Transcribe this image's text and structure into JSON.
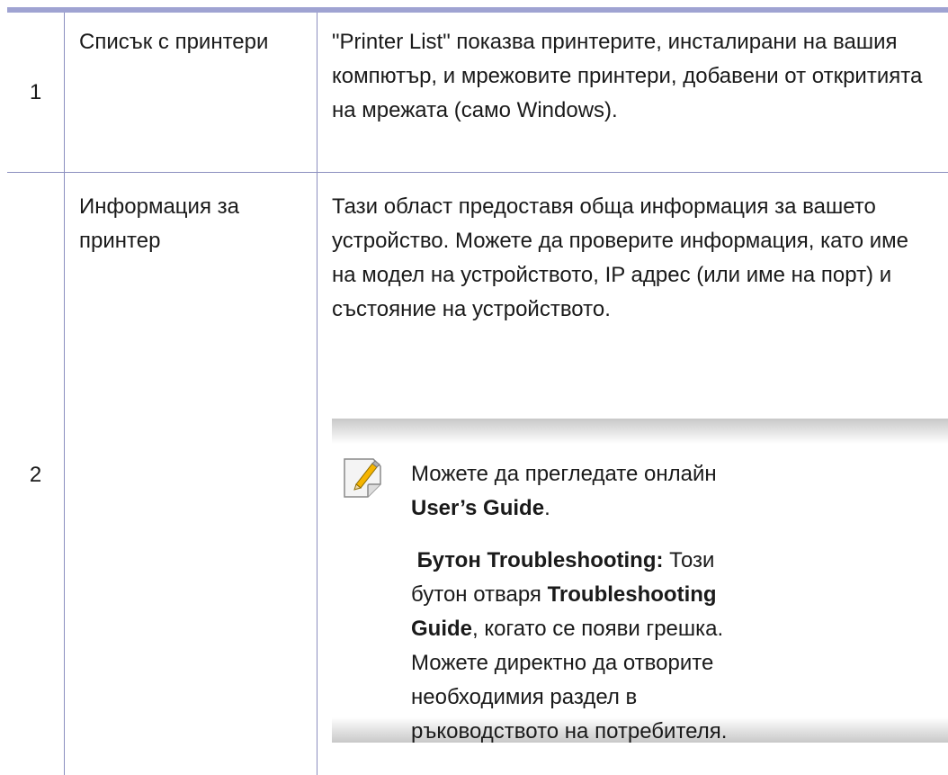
{
  "table": {
    "rows": [
      {
        "num": "1",
        "name": "Списък с принтери",
        "desc": "\"Printer List\" показва принтерите, инсталирани на вашия компютър, и мрежовите принтери, добавени от откритията на мрежата (само Windows)."
      },
      {
        "num": "2",
        "name": "Информация за принтер",
        "desc": "Тази област предоставя обща информация за вашето устройство. Можете да проверите информация, като име на модел на устройството, IP адрес (или име на порт) и състояние на устройството."
      }
    ]
  },
  "note": {
    "icon": "note-pencil-icon",
    "line1_prefix": "Можете да прегледате онлайн ",
    "line1_bold": "User’s Guide",
    "line1_suffix": ".",
    "line2_bold_prefix": "Бутон Troubleshooting:",
    "line2_text": " Този бутон отваря ",
    "line2_bold_guide": "Troubleshooting Guide",
    "line2_suffix": ", когато се появи грешка. Можете директно да отворите необходимия раздел в ръководството на потребителя."
  },
  "colors": {
    "rule": "#9fa3d2",
    "border": "#8c8fbf",
    "shade": "#c8c8c8"
  }
}
